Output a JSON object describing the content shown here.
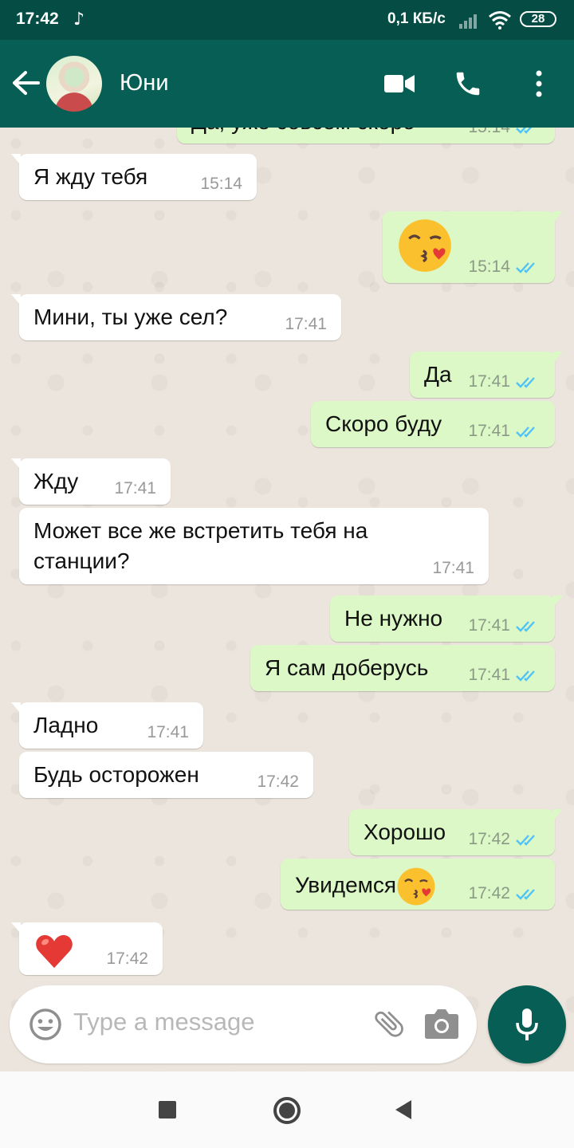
{
  "status_bar": {
    "time": "17:42",
    "tiktok_icon": "♪",
    "network_speed": "0,1 КБ/с",
    "battery": "28"
  },
  "header": {
    "contact_name": "Юни",
    "colors": {
      "header": "#075e54",
      "status": "#054d44"
    }
  },
  "messages": [
    {
      "dir": "out",
      "text": "Да, уже совсем скоро",
      "time": "15:14"
    },
    {
      "dir": "in",
      "text": "Я жду тебя",
      "time": "15:14"
    },
    {
      "dir": "out",
      "text": "",
      "emoji": "kiss-face",
      "time": "15:14"
    },
    {
      "dir": "in",
      "text": "Мини, ты уже сел?",
      "time": "17:41"
    },
    {
      "dir": "out",
      "text": "Да",
      "time": "17:41"
    },
    {
      "dir": "out",
      "text": "Скоро буду",
      "time": "17:41"
    },
    {
      "dir": "in",
      "text": "Жду",
      "time": "17:41"
    },
    {
      "dir": "in",
      "text": "Может все же встретить тебя на\nстанции?",
      "time": "17:41"
    },
    {
      "dir": "out",
      "text": "Не нужно",
      "time": "17:41"
    },
    {
      "dir": "out",
      "text": "Я сам доберусь",
      "time": "17:41"
    },
    {
      "dir": "in",
      "text": "Ладно",
      "time": "17:41"
    },
    {
      "dir": "in",
      "text": "Будь осторожен",
      "time": "17:42"
    },
    {
      "dir": "out",
      "text": "Хорошо",
      "time": "17:42"
    },
    {
      "dir": "out",
      "text": "Увидемся",
      "emoji": "kiss-face",
      "time": "17:42"
    },
    {
      "dir": "in",
      "text": "",
      "emoji": "red-heart",
      "time": "17:42"
    }
  ],
  "input": {
    "placeholder": "Type a message"
  },
  "colors": {
    "incoming": "#ffffff",
    "outgoing": "#dcf8c6",
    "read_ticks": "#4fc3f7",
    "accent": "#075e54"
  }
}
